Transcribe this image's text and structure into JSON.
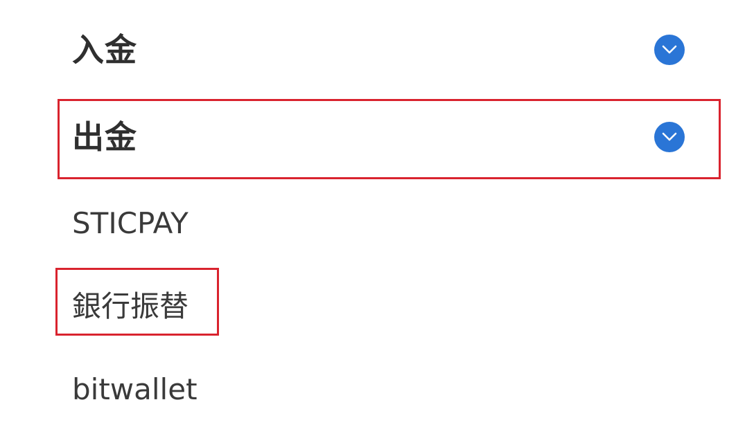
{
  "sections": [
    {
      "label": "入金",
      "icon": "chevron-down-icon",
      "expanded": false
    },
    {
      "label": "出金",
      "icon": "chevron-down-icon",
      "expanded": true
    }
  ],
  "withdraw_methods": [
    {
      "label": "STICPAY"
    },
    {
      "label": "銀行振替"
    },
    {
      "label": "bitwallet"
    }
  ],
  "colors": {
    "accent": "#2a75d6",
    "highlight": "#d9232e",
    "text": "#333333"
  }
}
